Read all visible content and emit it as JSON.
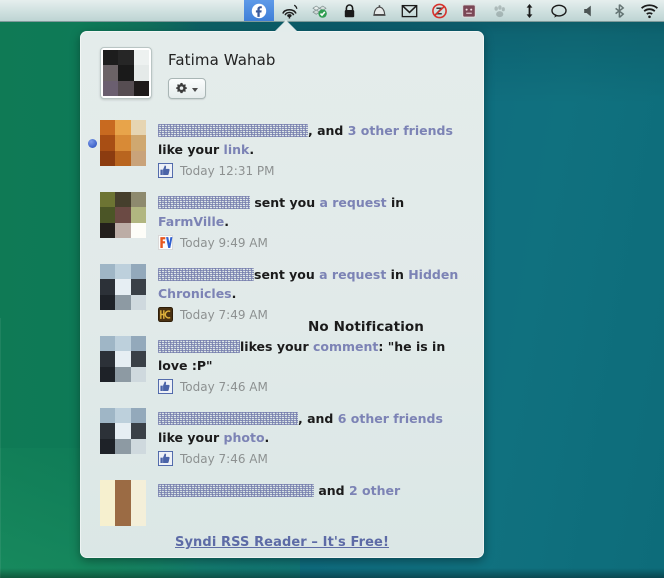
{
  "menubar": {
    "icons": [
      {
        "name": "facebook-notifier-icon",
        "label": "Facebook Notifications",
        "active": true
      },
      {
        "name": "airfoil-speaker-icon",
        "label": "Airfoil",
        "active": false
      },
      {
        "name": "dropbox-icon",
        "label": "Dropbox",
        "active": false
      },
      {
        "name": "lock-icon",
        "label": "Keychain Lock",
        "active": false
      },
      {
        "name": "bell-icon",
        "label": "Alerts",
        "active": false
      },
      {
        "name": "gmail-envelope-icon",
        "label": "Gmail",
        "active": false
      },
      {
        "name": "do-not-disturb-icon",
        "label": "Do Not Disturb",
        "active": false
      },
      {
        "name": "app-window-icon",
        "label": "App",
        "active": false
      },
      {
        "name": "paw-icon",
        "label": "Paw",
        "active": false
      },
      {
        "name": "updown-arrow-icon",
        "label": "Network Traffic",
        "active": false
      },
      {
        "name": "chat-bubble-icon",
        "label": "Messages",
        "active": false
      },
      {
        "name": "volume-icon",
        "label": "Volume",
        "active": false
      },
      {
        "name": "bluetooth-icon",
        "label": "Bluetooth",
        "active": false
      },
      {
        "name": "wifi-icon",
        "label": "Wi-Fi",
        "active": false
      }
    ]
  },
  "popup": {
    "header": {
      "user_name": "Fatima Wahab",
      "gear_button_label": "",
      "avatar_colors": [
        "#1d1d1d",
        "#262626",
        "#edf1f0",
        "#6b6366",
        "#1a1a1a",
        "#e5eae9",
        "#6b5f70",
        "#564d52",
        "#1e1a1a"
      ]
    },
    "overlay_text": "No Notification",
    "footer": {
      "link_text": "Syndi RSS Reader – It's Free!"
    },
    "notifications": [
      {
        "unread": true,
        "thumb_name": "thumbnail-woman-orange-scarf",
        "thumb_colors": [
          "#c86a20",
          "#e8a44a",
          "#e6d5b2",
          "#a84e14",
          "#d88a36",
          "#cfa870",
          "#8c3c10",
          "#b9651f",
          "#c9a37a"
        ],
        "segments": [
          {
            "type": "redacted",
            "width": 150
          },
          {
            "type": "plain",
            "text": ", and "
          },
          {
            "type": "link",
            "text": "3 other friends"
          },
          {
            "type": "plain",
            "text": " like your "
          },
          {
            "type": "link",
            "text": "link"
          },
          {
            "type": "plain",
            "text": "."
          }
        ],
        "app_icon": "facebook-thumbsup-icon",
        "time": "Today 12:31 PM"
      },
      {
        "unread": false,
        "thumb_name": "thumbnail-mosaic-olive",
        "thumb_colors": [
          "#6d7433",
          "#463f2d",
          "#8e8a6e",
          "#4b5526",
          "#6b4a44",
          "#b1b680",
          "#231f1c",
          "#bcada6",
          "#fdfdf8"
        ],
        "segments": [
          {
            "type": "redacted",
            "width": 92
          },
          {
            "type": "plain",
            "text": " sent you "
          },
          {
            "type": "link",
            "text": "a request"
          },
          {
            "type": "plain",
            "text": " in "
          },
          {
            "type": "link",
            "text": "FarmVille"
          },
          {
            "type": "plain",
            "text": "."
          }
        ],
        "app_icon": "farmville-icon",
        "time": "Today 9:49 AM"
      },
      {
        "unread": false,
        "thumb_name": "thumbnail-penguins",
        "thumb_colors": [
          "#9fb6c6",
          "#bdd0dc",
          "#93a9bb",
          "#2c3138",
          "#e6eef3",
          "#3a4047",
          "#1e2228",
          "#8d9aa3",
          "#cfd9de"
        ],
        "segments": [
          {
            "type": "redacted",
            "width": 96
          },
          {
            "type": "plain",
            "text": "sent you "
          },
          {
            "type": "link",
            "text": "a request"
          },
          {
            "type": "plain",
            "text": " in "
          },
          {
            "type": "link",
            "text": "Hidden Chronicles"
          },
          {
            "type": "plain",
            "text": "."
          }
        ],
        "app_icon": "hidden-chronicles-icon",
        "time": "Today 7:49 AM"
      },
      {
        "unread": false,
        "thumb_name": "thumbnail-penguins",
        "thumb_colors": [
          "#9fb6c6",
          "#bdd0dc",
          "#93a9bb",
          "#2c3138",
          "#e6eef3",
          "#3a4047",
          "#1e2228",
          "#8d9aa3",
          "#cfd9de"
        ],
        "segments": [
          {
            "type": "redacted",
            "width": 82
          },
          {
            "type": "plain",
            "text": "likes your "
          },
          {
            "type": "link",
            "text": "comment"
          },
          {
            "type": "plain",
            "text": ": \"he is in love :P\""
          }
        ],
        "app_icon": "facebook-thumbsup-icon",
        "time": "Today 7:46 AM"
      },
      {
        "unread": false,
        "thumb_name": "thumbnail-penguins",
        "thumb_colors": [
          "#9fb6c6",
          "#bdd0dc",
          "#93a9bb",
          "#2c3138",
          "#e6eef3",
          "#3a4047",
          "#1e2228",
          "#8d9aa3",
          "#cfd9de"
        ],
        "segments": [
          {
            "type": "redacted",
            "width": 140
          },
          {
            "type": "plain",
            "text": ", and "
          },
          {
            "type": "link",
            "text": "6 other friends"
          },
          {
            "type": "plain",
            "text": " like your "
          },
          {
            "type": "link",
            "text": "photo"
          },
          {
            "type": "plain",
            "text": "."
          }
        ],
        "app_icon": "facebook-thumbsup-icon",
        "time": "Today 7:46 AM"
      },
      {
        "unread": false,
        "thumb_name": "thumbnail-cream-brown",
        "thumb_colors": [
          "#f6f0cf",
          "#9b6b44",
          "#f4efd9",
          "#f6f0cf",
          "#9b6b44",
          "#f4efd9",
          "#f6f0cf",
          "#9b6b44",
          "#f4efd9"
        ],
        "segments": [
          {
            "type": "redacted",
            "width": 156
          },
          {
            "type": "plain",
            "text": " and "
          },
          {
            "type": "link",
            "text": "2 other"
          }
        ],
        "app_icon": "",
        "time": ""
      }
    ]
  }
}
